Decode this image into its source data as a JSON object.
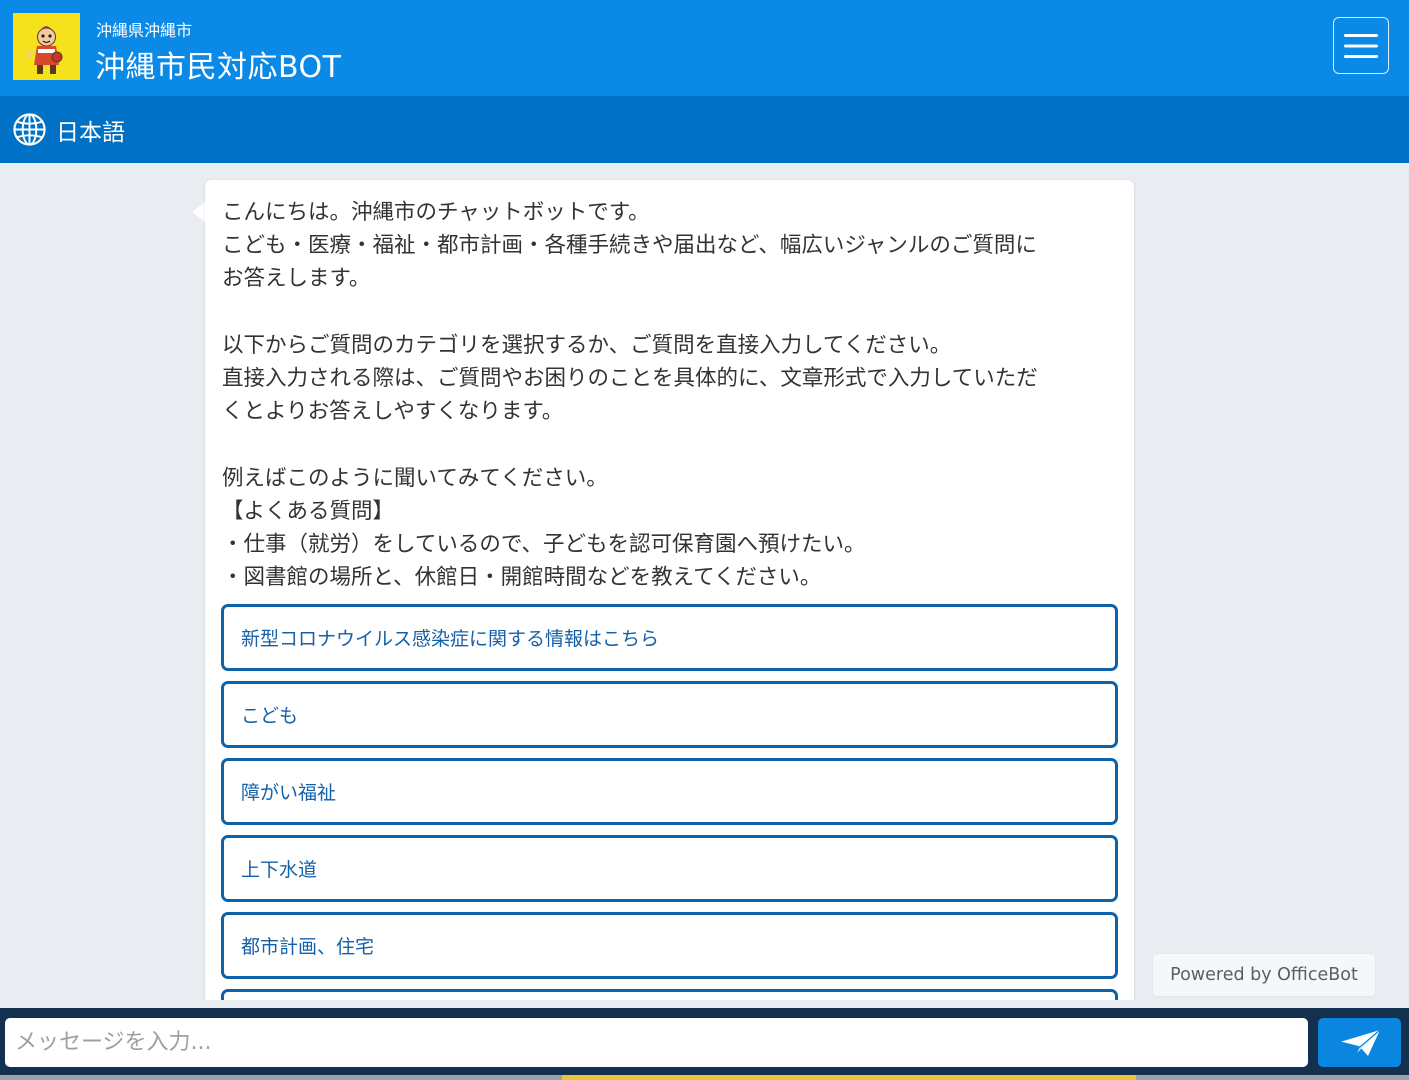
{
  "header": {
    "org_name": "沖縄県沖縄市",
    "title": "沖縄市民対応BOT",
    "logo_icon": "mascot-logo-icon",
    "menu_icon": "hamburger-menu-icon",
    "colors": {
      "header_bg": "#0a8ae6",
      "language_bar_bg": "#0071c5"
    }
  },
  "language_bar": {
    "icon": "globe-icon",
    "label": "日本語"
  },
  "chat": {
    "message": "こんにちは。沖縄市のチャットボットです。\nこども・医療・福祉・都市計画・各種手続きや届出など、幅広いジャンルのご質問に\nお答えします。\n\n以下からご質問のカテゴリを選択するか、ご質問を直接入力してください。\n直接入力される際は、ご質問やお困りのことを具体的に、文章形式で入力していただ\nくとよりお答えしやすくなります。\n\n例えばこのように聞いてみてください。\n【よくある質問】\n・仕事（就労）をしているので、子どもを認可保育園へ預けたい。\n・図書館の場所と、休館日・開館時間などを教えてください。",
    "options": [
      "新型コロナウイルス感染症に関する情報はこちら",
      "こども",
      "障がい福祉",
      "上下水道",
      "都市計画、住宅"
    ],
    "option_border_color": "#0e62aa"
  },
  "powered_by": "Powered by OfficeBot",
  "input": {
    "placeholder": "メッセージを入力...",
    "value": "",
    "send_icon": "paper-plane-send-icon",
    "send_color": "#0a86e0"
  }
}
